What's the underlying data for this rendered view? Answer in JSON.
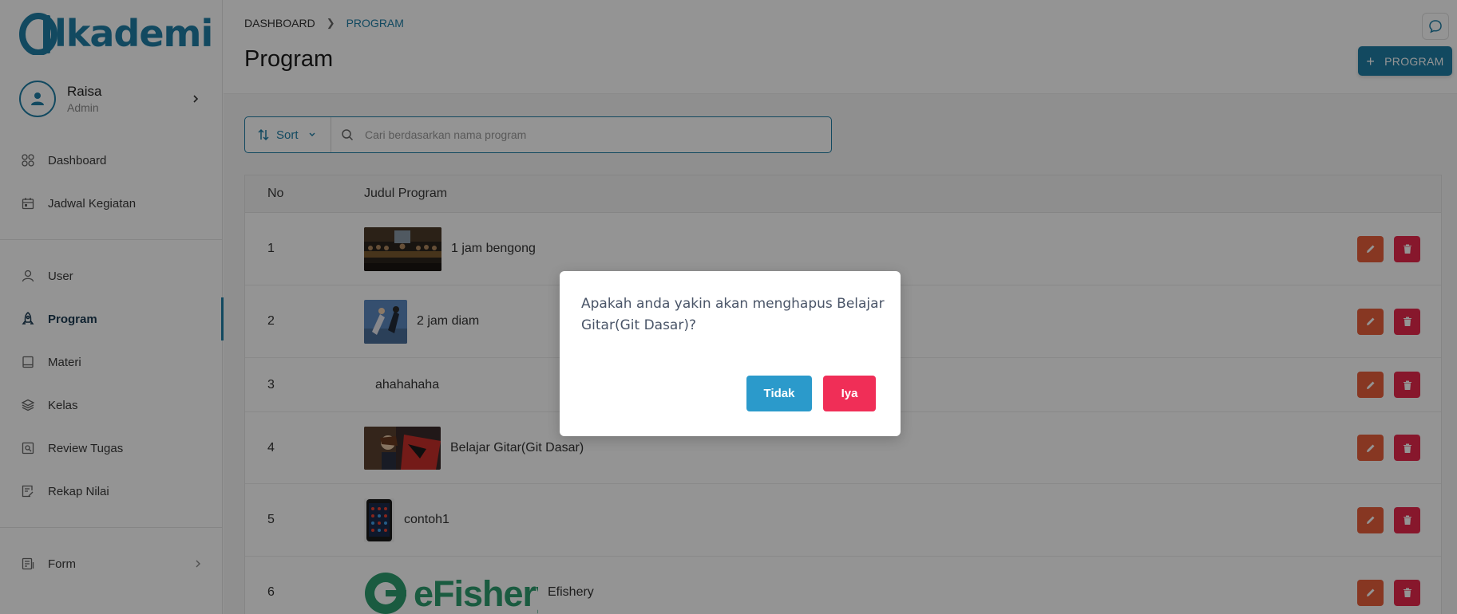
{
  "brand": {
    "logo_text": "lkademi",
    "accent": "#1f7fa6"
  },
  "profile": {
    "name": "Raisa",
    "role": "Admin"
  },
  "sidebar": {
    "groups": [
      [
        {
          "label": "Dashboard",
          "icon": "grid-icon"
        },
        {
          "label": "Jadwal Kegiatan",
          "icon": "calendar-icon"
        }
      ],
      [
        {
          "label": "User",
          "icon": "user-icon"
        },
        {
          "label": "Program",
          "icon": "rocket-icon",
          "active": true
        },
        {
          "label": "Materi",
          "icon": "book-icon"
        },
        {
          "label": "Kelas",
          "icon": "layers-icon"
        },
        {
          "label": "Review Tugas",
          "icon": "search-doc-icon"
        },
        {
          "label": "Rekap Nilai",
          "icon": "edit-doc-icon"
        }
      ],
      [
        {
          "label": "Form",
          "icon": "form-icon",
          "has_submenu": true
        }
      ]
    ]
  },
  "header": {
    "breadcrumb": [
      "DASHBOARD",
      "PROGRAM"
    ],
    "title": "Program",
    "add_button": "PROGRAM"
  },
  "toolbar": {
    "sort_label": "Sort",
    "search_placeholder": "Cari berdasarkan nama program"
  },
  "table": {
    "columns": [
      "No",
      "Judul Program"
    ],
    "rows": [
      {
        "no": "1",
        "title": "1 jam bengong",
        "thumb": "painting"
      },
      {
        "no": "2",
        "title": "2 jam diam",
        "thumb": "anime"
      },
      {
        "no": "3",
        "title": "ahahahaha",
        "thumb": "none"
      },
      {
        "no": "4",
        "title": "Belajar Gitar(Git Dasar)",
        "thumb": "anime-red"
      },
      {
        "no": "5",
        "title": "contoh1",
        "thumb": "phone"
      },
      {
        "no": "6",
        "title": "Efishery",
        "thumb": "efishery",
        "thumb_text": "eFishery"
      }
    ]
  },
  "modal": {
    "message": "Apakah anda yakin akan menghapus Belajar Gitar(Git Dasar)?",
    "cancel_label": "Tidak",
    "confirm_label": "Iya"
  }
}
